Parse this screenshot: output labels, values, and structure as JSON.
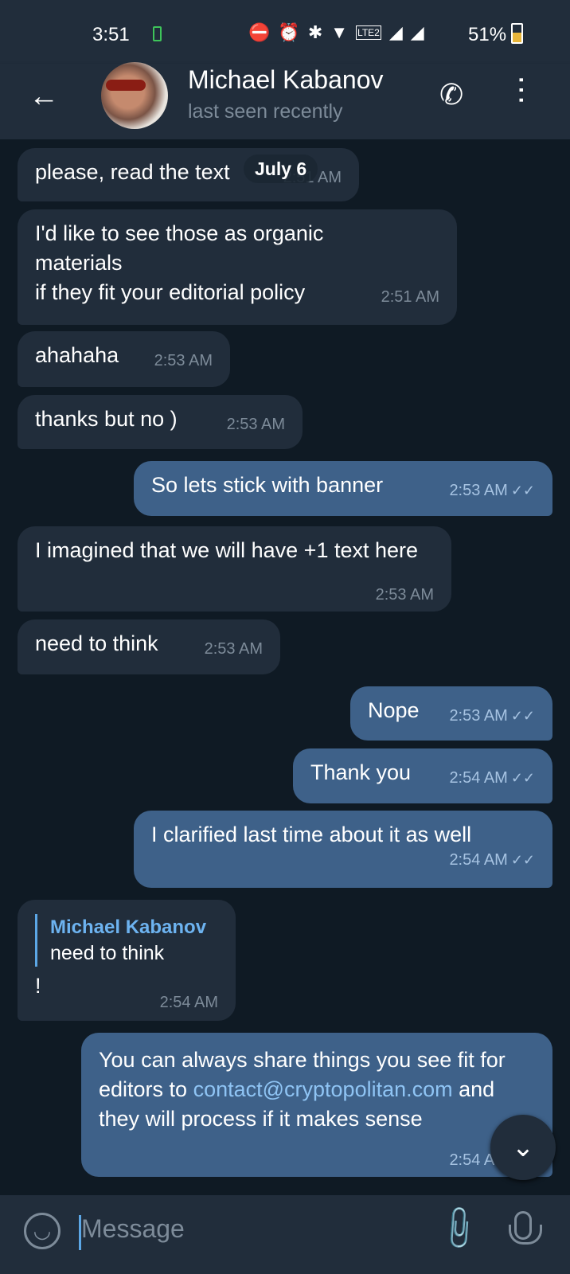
{
  "status_bar": {
    "time": "3:51",
    "battery": "51%",
    "icons": [
      "charging-icon",
      "dnd-icon",
      "alarm-icon",
      "bluetooth-icon",
      "wifi-icon",
      "volte2-icon",
      "signal-roaming-icon",
      "signal-icon",
      "battery-icon"
    ]
  },
  "header": {
    "name": "Michael Kabanov",
    "status": "last seen recently"
  },
  "date_pill": "July 6",
  "messages": [
    {
      "dir": "in",
      "text": "please, read the text",
      "time": "2:51 AM"
    },
    {
      "dir": "in",
      "text": "I'd like to see those as organic materials\nif they fit your editorial policy",
      "time": "2:51 AM"
    },
    {
      "dir": "in",
      "text": "ahahaha",
      "time": "2:53 AM"
    },
    {
      "dir": "in",
      "text": "thanks but no )",
      "time": "2:53 AM"
    },
    {
      "dir": "out",
      "text": "So lets stick with banner",
      "time": "2:53 AM",
      "read": true
    },
    {
      "dir": "in",
      "text": "I imagined that we will have +1 text here",
      "time": "2:53 AM"
    },
    {
      "dir": "in",
      "text": "need to think",
      "time": "2:53 AM"
    },
    {
      "dir": "out",
      "text": "Nope",
      "time": "2:53 AM",
      "read": true
    },
    {
      "dir": "out",
      "text": "Thank you",
      "time": "2:54 AM",
      "read": true
    },
    {
      "dir": "out",
      "text": "I clarified last time about it as well",
      "time": "2:54 AM",
      "read": true
    },
    {
      "dir": "in",
      "reply_to": {
        "name": "Michael Kabanov",
        "text": "need to think"
      },
      "text": "!",
      "time": "2:54 AM"
    },
    {
      "dir": "out",
      "text_before": "You can always share things you see fit for editors to ",
      "link": "contact@cryptopolitan.com",
      "text_after": " and they will process if it makes sense",
      "time": "2:54 AM",
      "read": true
    }
  ],
  "input": {
    "placeholder": "Message"
  },
  "colors": {
    "incoming": "#212d3b",
    "outgoing": "#3e6189",
    "background": "#0f1a24",
    "accent": "#5ca7e6"
  }
}
